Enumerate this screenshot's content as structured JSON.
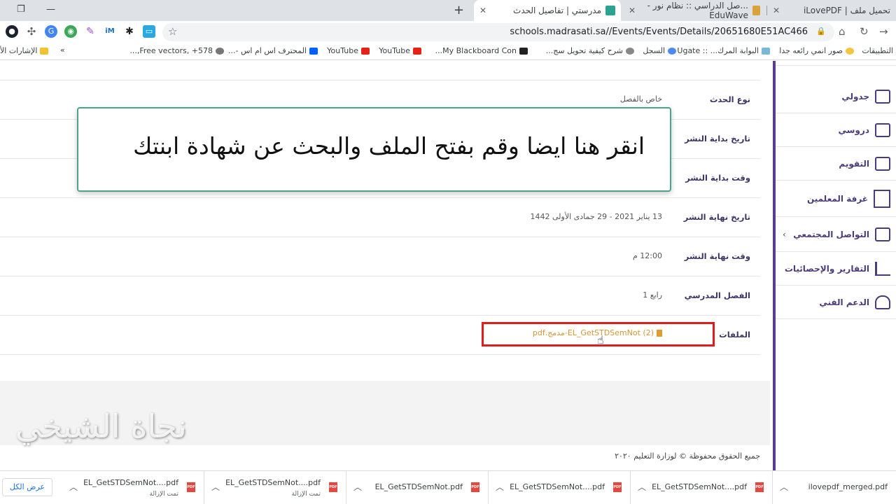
{
  "browser": {
    "tabs": [
      {
        "title": "تحميل ملف | iLovePDF",
        "active": false
      },
      {
        "title": "...صل الدراسي :: نظام نور - EduWave",
        "active": false
      },
      {
        "title": "مدرستي | تفاصيل الحدث",
        "active": true
      }
    ],
    "url": "schools.madrasati.sa//Events/Events/Details/20651680E51AC466",
    "bookmarks": [
      "التطبيقات",
      "صور انمي رائعه جدا",
      "البوابة المرك... :: Ugate",
      "السجل",
      "شرح كيفية تحويل سج...",
      "My Blackboard Con...",
      "YouTube",
      "YouTube",
      "المحترف اس ام اس -...",
      "Free vectors, +578,...",
      "الإشارات الأ"
    ],
    "bookmarks_overflow": "»"
  },
  "sidebar": {
    "items": [
      {
        "label": "جدولي",
        "icon": "calendar-icon"
      },
      {
        "label": "دروسي",
        "icon": "lessons-icon"
      },
      {
        "label": "التقويم",
        "icon": "calendar-grid-icon"
      },
      {
        "label": "غرفة المعلمين",
        "icon": "teacher-board-icon"
      },
      {
        "label": "التواصل المجتمعي",
        "icon": "community-icon",
        "chevron": "‹"
      },
      {
        "label": "التقارير والإحصائيات",
        "icon": "bar-chart-icon"
      },
      {
        "label": "الدعم الفني",
        "icon": "headset-icon"
      }
    ]
  },
  "details": {
    "rows": [
      {
        "label": "نوع الحدث",
        "value": "خاص بالفصل"
      },
      {
        "label": "تاريخ بداية النشر",
        "value": ""
      },
      {
        "label": "وقت بداية النشر",
        "value": ""
      },
      {
        "label": "تاريخ نهاية النشر",
        "value": "13 يناير 2021 - 29 جمادى الأولى 1442"
      },
      {
        "label": "وقت نهاية النشر",
        "value": "12:00 م"
      },
      {
        "label": "الفصل المدرسي",
        "value": "رابع 1"
      },
      {
        "label": "الملفات",
        "value": "EL_GetSTDSemNot (2)-مدمج.pdf"
      }
    ]
  },
  "footer": {
    "text": "جميع الحقوق محفوظة © لوزارة التعليم ٢٠٢٠"
  },
  "overlay": {
    "callout_text": "انقر هنا ايضا وقم بفتح الملف والبحث عن شهادة ابنتك",
    "watermark": "نجاة الشيخي"
  },
  "downloads": {
    "items": [
      {
        "name": "ilovepdf_merged.pdf",
        "status": ""
      },
      {
        "name": "EL_GetSTDSemNot....pdf",
        "status": ""
      },
      {
        "name": "EL_GetSTDSemNot....pdf",
        "status": ""
      },
      {
        "name": "EL_GetSTDSemNot.pdf",
        "status": ""
      },
      {
        "name": "EL_GetSTDSemNot....pdf",
        "status": "تمت الإزالة"
      },
      {
        "name": "EL_GetSTDSemNot....pdf",
        "status": "تمت الإزالة"
      }
    ],
    "show_all": "عرض الكل",
    "pdf_badge": "PDF"
  },
  "colors": {
    "sidebar_accent": "#5a3d8e",
    "callout_border": "#4aa48c",
    "highlight_red": "#e21b1b",
    "file_link": "#d89432"
  }
}
